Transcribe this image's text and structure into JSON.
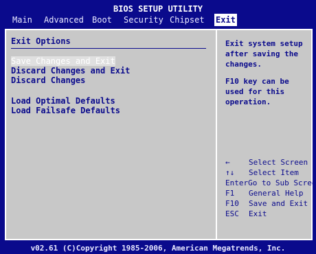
{
  "app_title": "BIOS SETUP UTILITY",
  "menu": [
    {
      "label": "Main",
      "active": false
    },
    {
      "label": "Advanced",
      "active": false
    },
    {
      "label": "Boot",
      "active": false
    },
    {
      "label": "Security",
      "active": false
    },
    {
      "label": "Chipset",
      "active": false
    },
    {
      "label": "Exit",
      "active": true
    }
  ],
  "section_title": "Exit Options",
  "options": [
    {
      "label": "Save Changes and Exit",
      "selected": true
    },
    {
      "label": "Discard Changes and Exit",
      "selected": false
    },
    {
      "label": "Discard Changes",
      "selected": false
    },
    {
      "label": "Load Optimal Defaults",
      "selected": false
    },
    {
      "label": "Load Failsafe Defaults",
      "selected": false
    }
  ],
  "help": {
    "line1": "Exit system setup after saving the changes.",
    "line2": "F10 key can be used for this operation."
  },
  "keys": [
    {
      "key": "←",
      "desc": "Select Screen"
    },
    {
      "key": "↑↓",
      "desc": "Select Item"
    },
    {
      "key": "Enter",
      "desc": "Go to Sub Screen"
    },
    {
      "key": "F1",
      "desc": "General Help"
    },
    {
      "key": "F10",
      "desc": "Save and Exit"
    },
    {
      "key": "ESC",
      "desc": "Exit"
    }
  ],
  "footer": "v02.61 (C)Copyright 1985-2006, American Megatrends, Inc."
}
